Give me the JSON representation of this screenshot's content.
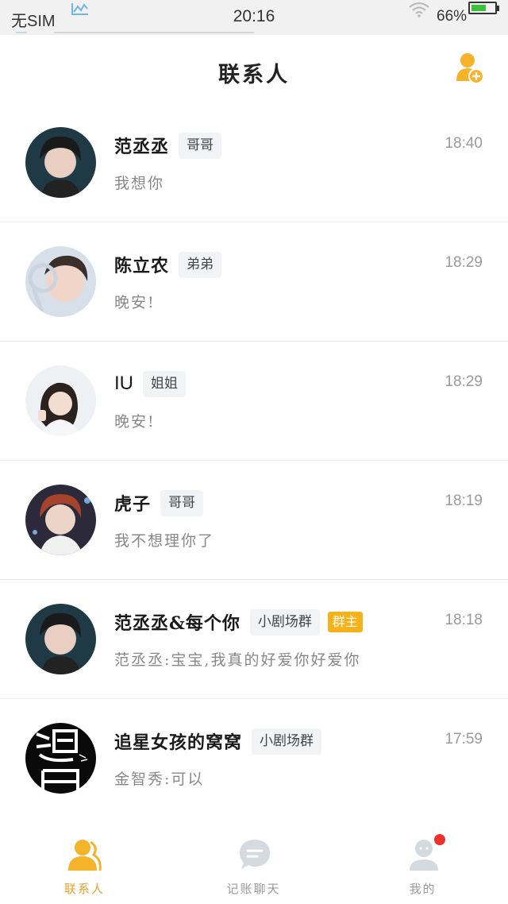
{
  "status_bar": {
    "carrier": "无SIM",
    "time": "20:16",
    "battery_percent": "66%",
    "battery_level": 0.66
  },
  "header": {
    "title": "联系人",
    "add_icon": "add-contact-icon"
  },
  "contacts": [
    {
      "name": "范丞丞",
      "tag": "哥哥",
      "badge": "",
      "time": "18:40",
      "message": "我想你"
    },
    {
      "name": "陈立农",
      "tag": "弟弟",
      "badge": "",
      "time": "18:29",
      "message": "晚安!"
    },
    {
      "name": "IU",
      "tag": "姐姐",
      "badge": "",
      "time": "18:29",
      "message": "晚安!"
    },
    {
      "name": "虎子",
      "tag": "哥哥",
      "badge": "",
      "time": "18:19",
      "message": "我不想理你了"
    },
    {
      "name": "范丞丞&每个你",
      "tag": "小剧场群",
      "badge": "群主",
      "time": "18:18",
      "message": "范丞丞:宝宝,我真的好爱你好爱你"
    },
    {
      "name": "追星女孩的窝窝",
      "tag": "小剧场群",
      "badge": "",
      "time": "17:59",
      "message": "金智秀:可以"
    }
  ],
  "tabbar": {
    "tabs": [
      {
        "label": "联系人",
        "icon": "contacts-icon",
        "active": true
      },
      {
        "label": "记账聊天",
        "icon": "chat-bubble-icon",
        "active": false
      },
      {
        "label": "我的",
        "icon": "profile-icon",
        "active": false,
        "notification": true
      }
    ]
  },
  "colors": {
    "accent": "#f5b32a",
    "badge": "#f7b21a",
    "notification_dot": "#f0302a",
    "tag_bg": "#f2f3f5"
  }
}
